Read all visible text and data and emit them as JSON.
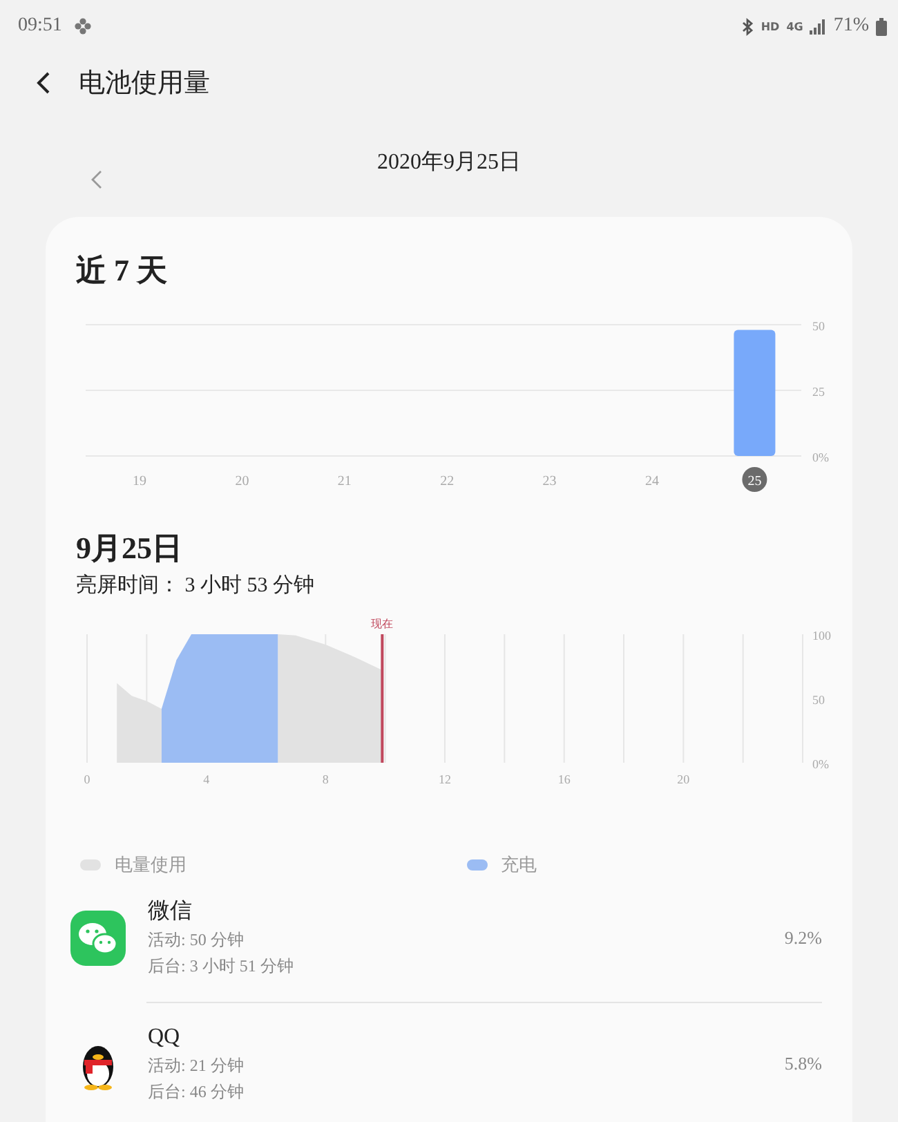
{
  "status_bar": {
    "time": "09:51",
    "indicators": [
      "HD",
      "4G"
    ],
    "battery": "71%"
  },
  "header": {
    "title": "电池使用量"
  },
  "date_nav": {
    "date": "2020年9月25日"
  },
  "week": {
    "selected_category": "25",
    "chart_data": {
      "type": "bar",
      "title": "近 7 天",
      "categories": [
        "19",
        "20",
        "21",
        "22",
        "23",
        "24",
        "25"
      ],
      "values": [
        0,
        0,
        0,
        0,
        0,
        0,
        48
      ],
      "ylim": [
        0,
        50
      ],
      "yticks": [
        {
          "value": 0,
          "label": "0%"
        },
        25,
        50
      ],
      "color": "#78a9fa"
    }
  },
  "day": {
    "title": "9月25日",
    "screen_time": "亮屏时间： 3 小时 53 分钟",
    "chart_data": {
      "type": "area",
      "x": [
        1,
        1.5,
        2,
        2.5,
        3,
        3.5,
        4,
        5,
        6,
        6.4,
        7,
        8,
        9,
        9.9
      ],
      "series": [
        {
          "name": "电量使用",
          "color": "#e2e2e2",
          "values": [
            62,
            52,
            48,
            42,
            null,
            null,
            null,
            null,
            null,
            100,
            99,
            92,
            82,
            72
          ]
        },
        {
          "name": "充电",
          "color": "#9bbcf3",
          "values": [
            null,
            null,
            null,
            42,
            80,
            100,
            100,
            100,
            100,
            100,
            null,
            null,
            null,
            null
          ]
        }
      ],
      "xlim": [
        0,
        24
      ],
      "ylim": [
        0,
        100
      ],
      "xticks": [
        0,
        4,
        8,
        12,
        16,
        20
      ],
      "yticks": [
        {
          "value": 0,
          "label": "0%"
        },
        50,
        100
      ],
      "grid": true,
      "ref_lines": [
        {
          "axis": "x",
          "value": 9.9,
          "label": "现在",
          "color": "#c0475c"
        }
      ]
    }
  },
  "apps": [
    {
      "kind": "wechat",
      "name": "微信",
      "active": "活动: 50 分钟",
      "background": "后台: 3 小时 51 分钟",
      "percent": "9.2%"
    },
    {
      "kind": "qq",
      "name": "QQ",
      "active": "活动: 21 分钟",
      "background": "后台: 46 分钟",
      "percent": "5.8%"
    }
  ]
}
